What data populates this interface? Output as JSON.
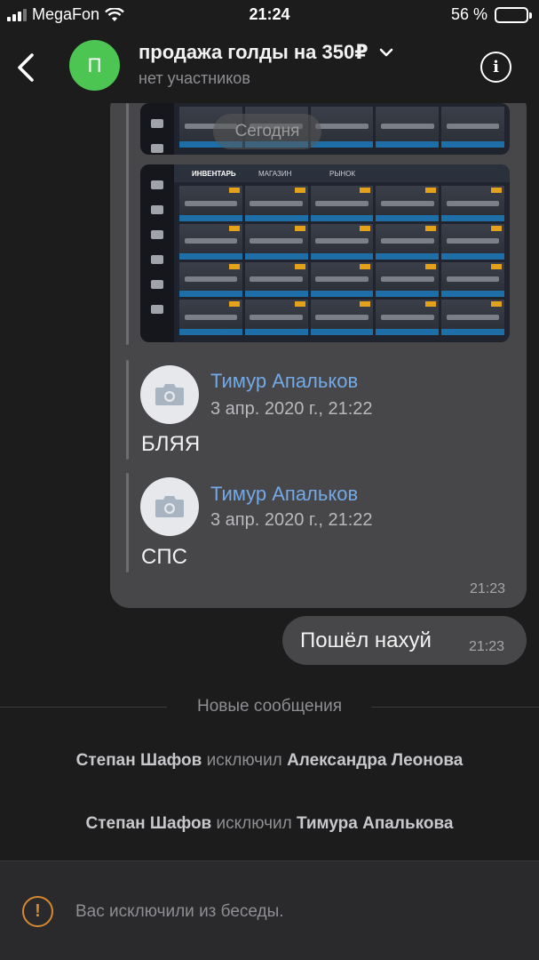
{
  "status_bar": {
    "carrier": "MegaFon",
    "time": "21:24",
    "battery": "56 %",
    "battery_level": 0.56
  },
  "header": {
    "avatar_letter": "П",
    "avatar_color": "#4cc552",
    "title": "продажа голды на 350₽",
    "subtitle": "нет участников"
  },
  "thread": {
    "today_label": "Сегодня",
    "forwarded": [
      {
        "name": "Тимур Апальков",
        "date": "3 апр. 2020 г., 21:22",
        "text": "БЛЯЯ"
      },
      {
        "name": "Тимур Апальков",
        "date": "3 апр. 2020 г., 21:22",
        "text": "СПС"
      }
    ],
    "bubble_time": "21:23",
    "screenshot_tabs": [
      "ИНВЕНТАРЬ",
      "МАГАЗИН",
      "РЫНОК"
    ],
    "my_message": {
      "text": "Пошёл нахуй",
      "time": "21:23"
    }
  },
  "new_messages_label": "Новые сообщения",
  "system_messages": [
    {
      "actor": "Степан Шафов",
      "action": "исключил",
      "target": "Александра Леонова"
    },
    {
      "actor": "Степан Шафов",
      "action": "исключил",
      "target": "Тимура Апалькова"
    }
  ],
  "footer": {
    "text": "Вас исключили из беседы."
  },
  "colors": {
    "accent_name": "#73a9e6",
    "warning": "#d6892e",
    "bubble": "#474749",
    "background": "#1c1c1c"
  }
}
